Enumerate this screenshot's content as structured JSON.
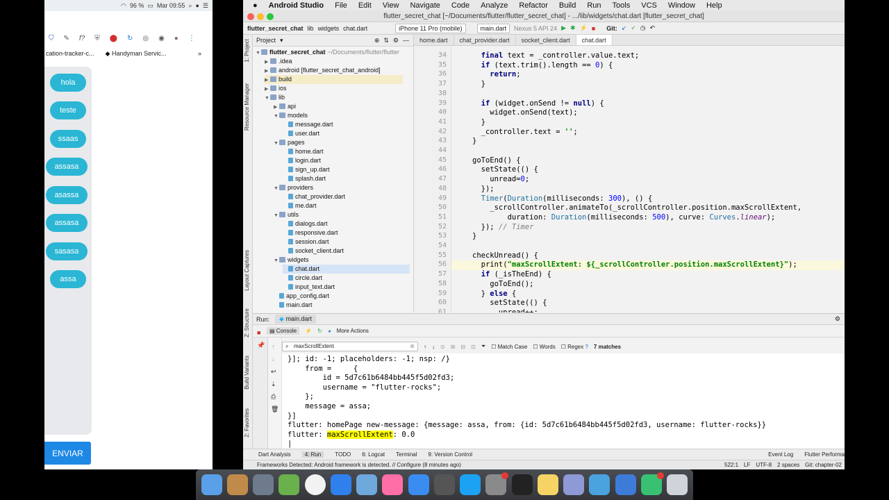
{
  "phone": {
    "status": {
      "battery": "96 %",
      "time": "Mar 09:55"
    },
    "bookmarks": [
      "cation-tracker-c...",
      "Handyman Servic..."
    ],
    "bubbles": [
      "hola",
      "teste",
      "ssaas",
      "assasa",
      "asassa",
      "assasa",
      "sasasa",
      "assa"
    ],
    "send_label": "ENVIAR"
  },
  "mac_menu": [
    "Android Studio",
    "File",
    "Edit",
    "View",
    "Navigate",
    "Code",
    "Analyze",
    "Refactor",
    "Build",
    "Run",
    "Tools",
    "VCS",
    "Window",
    "Help"
  ],
  "window_title": "flutter_secret_chat [~/Documents/flutter/flutter_secret_chat] - .../lib/widgets/chat.dart [flutter_secret_chat]",
  "nav": {
    "crumbs": [
      "flutter_secret_chat",
      "lib",
      "widgets",
      "chat.dart"
    ],
    "device": "iPhone 11 Pro (mobile)",
    "run_config": "main.dart",
    "emulator": "Nexus 5 API 24",
    "git": "Git:"
  },
  "side_labels": [
    "1: Project",
    "Resource Manager",
    "Layout Captures",
    "Z: Structure",
    "Build Variants",
    "2: Favorites"
  ],
  "project": {
    "header": "Project",
    "tree": [
      {
        "label": "flutter_secret_chat",
        "extra": "~/Documents/flutter/flutter",
        "depth": 0,
        "type": "folder",
        "open": true
      },
      {
        "label": ".idea",
        "depth": 1,
        "type": "folder"
      },
      {
        "label": "android [flutter_secret_chat_android]",
        "depth": 1,
        "type": "folder"
      },
      {
        "label": "build",
        "depth": 1,
        "type": "folder"
      },
      {
        "label": "ios",
        "depth": 1,
        "type": "folder"
      },
      {
        "label": "lib",
        "depth": 1,
        "type": "folder",
        "open": true
      },
      {
        "label": "api",
        "depth": 2,
        "type": "folder"
      },
      {
        "label": "models",
        "depth": 2,
        "type": "folder",
        "open": true
      },
      {
        "label": "message.dart",
        "depth": 3,
        "type": "file"
      },
      {
        "label": "user.dart",
        "depth": 3,
        "type": "file"
      },
      {
        "label": "pages",
        "depth": 2,
        "type": "folder",
        "open": true
      },
      {
        "label": "home.dart",
        "depth": 3,
        "type": "file"
      },
      {
        "label": "login.dart",
        "depth": 3,
        "type": "file"
      },
      {
        "label": "sign_up.dart",
        "depth": 3,
        "type": "file"
      },
      {
        "label": "splash.dart",
        "depth": 3,
        "type": "file"
      },
      {
        "label": "providers",
        "depth": 2,
        "type": "folder",
        "open": true
      },
      {
        "label": "chat_provider.dart",
        "depth": 3,
        "type": "file"
      },
      {
        "label": "me.dart",
        "depth": 3,
        "type": "file"
      },
      {
        "label": "utils",
        "depth": 2,
        "type": "folder",
        "open": true
      },
      {
        "label": "dialogs.dart",
        "depth": 3,
        "type": "file"
      },
      {
        "label": "responsive.dart",
        "depth": 3,
        "type": "file"
      },
      {
        "label": "session.dart",
        "depth": 3,
        "type": "file"
      },
      {
        "label": "socket_client.dart",
        "depth": 3,
        "type": "file"
      },
      {
        "label": "widgets",
        "depth": 2,
        "type": "folder",
        "open": true
      },
      {
        "label": "chat.dart",
        "depth": 3,
        "type": "file"
      },
      {
        "label": "circle.dart",
        "depth": 3,
        "type": "file"
      },
      {
        "label": "input_text.dart",
        "depth": 3,
        "type": "file"
      },
      {
        "label": "app_config.dart",
        "depth": 2,
        "type": "file"
      },
      {
        "label": "main.dart",
        "depth": 2,
        "type": "file"
      }
    ]
  },
  "editor": {
    "tabs": [
      "home.dart",
      "chat_provider.dart",
      "socket_client.dart",
      "chat.dart"
    ],
    "active_tab": "chat.dart",
    "first_line": 34,
    "lines": [
      "  final text = _controller.value.text;",
      "  if (text.trim().length == 0) {",
      "    return;",
      "  }",
      "",
      "  if (widget.onSend != null) {",
      "    widget.onSend(text);",
      "  }",
      "  _controller.text = '';",
      "}",
      "",
      "goToEnd() {",
      "  setState(() {",
      "    unread=0;",
      "  });",
      "  Timer(Duration(milliseconds: 300), () {",
      "    _scrollController.animateTo(_scrollController.position.maxScrollExtent,",
      "        duration: Duration(milliseconds: 500), curve: Curves.linear);",
      "  }); // Timer",
      "}",
      "",
      "checkUnread() {",
      "  print(\"maxScrollExtent: ${_scrollController.position.maxScrollExtent}\");",
      "  if (_isTheEnd) {",
      "    goToEnd();",
      "  } else {",
      "    setState(() {",
      "      unread++;"
    ]
  },
  "run": {
    "label": "Run:",
    "tab": "main.dart",
    "console_tab": "Console",
    "more_actions": "More Actions",
    "search_value": "maxScrollExtent",
    "match_case": "Match Case",
    "words": "Words",
    "regex": "Regex",
    "regex_help": "?",
    "matches": "7 matches",
    "output": [
      "}]; id: -1; placeholders: -1; nsp: /}",
      "    from =     {",
      "        id = 5d7c61b6484bb445f5d02fd3;",
      "        username = \"flutter-rocks\";",
      "    };",
      "    message = assa;",
      "}]",
      "flutter: homePage new-message: {message: assa, from: {id: 5d7c61b6484bb445f5d02fd3, username: flutter-rocks}}",
      "flutter: maxScrollExtent: 0.0"
    ]
  },
  "bottom_tabs": [
    "Dart Analysis",
    "4: Run",
    "TODO",
    "6: Logcat",
    "Terminal",
    "9: Version Control",
    "Event Log",
    "Flutter Performa"
  ],
  "status": {
    "message": "Frameworks Detected: Android framework is detected. // Configure (8 minutes ago)",
    "position": "522:1",
    "line_sep": "LF",
    "encoding": "UTF-8",
    "indent": "2 spaces",
    "branch": "Git: chapter-02"
  },
  "dock_icons": [
    "finder-icon",
    "archive-icon",
    "launchpad-icon",
    "android-studio-icon",
    "chrome-icon",
    "vscode-icon",
    "preview-icon",
    "itunes-icon",
    "xcode-icon",
    "fork-icon",
    "app-store-icon",
    "system-preferences-icon",
    "terminal-icon",
    "notes-icon",
    "vectornator-icon",
    "folder-icon",
    "phpstorm-icon",
    "facetime-icon",
    "trash-icon"
  ],
  "colors": {
    "bubble": "#2ab6d4",
    "send": "#1e88e5",
    "highlight": "#ffff00"
  }
}
